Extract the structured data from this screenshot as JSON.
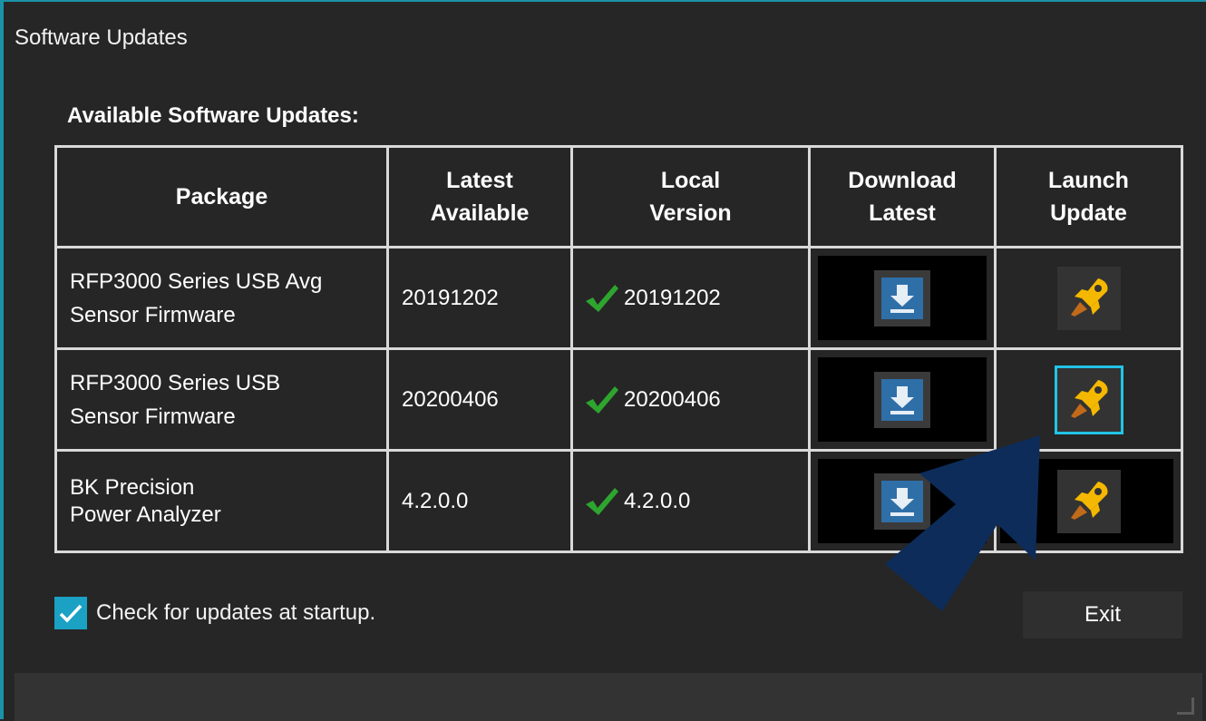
{
  "window": {
    "title": "Software Updates"
  },
  "section": {
    "heading": "Available Software Updates:"
  },
  "table": {
    "headers": {
      "package": "Package",
      "latest_line1": "Latest",
      "latest_line2": "Available",
      "local_line1": "Local",
      "local_line2": "Version",
      "download_line1": "Download",
      "download_line2": "Latest",
      "launch_line1": "Launch",
      "launch_line2": "Update"
    },
    "rows": [
      {
        "package_line1": "RFP3000 Series USB Avg",
        "package_line2": "Sensor Firmware",
        "latest": "20191202",
        "local": "20191202"
      },
      {
        "package_line1": "RFP3000 Series USB",
        "package_line2": "Sensor Firmware",
        "latest": "20200406",
        "local": "20200406"
      },
      {
        "package_line1": "BK Precision",
        "package_line2": "Power Analyzer",
        "latest": "4.2.0.0",
        "local": "4.2.0.0"
      }
    ]
  },
  "startup": {
    "label": "Check for updates at startup.",
    "checked": true
  },
  "buttons": {
    "exit": "Exit"
  },
  "icons": {
    "download": "download-icon",
    "launch": "rocket-icon",
    "check": "checkmark-icon",
    "arrow": "pointer-arrow-icon"
  },
  "colors": {
    "accent": "#1ba1c4",
    "focus": "#22c4e6",
    "check_green": "#2ea52e",
    "rocket_yellow": "#f5b800",
    "arrow_navy": "#0d2c5a"
  }
}
